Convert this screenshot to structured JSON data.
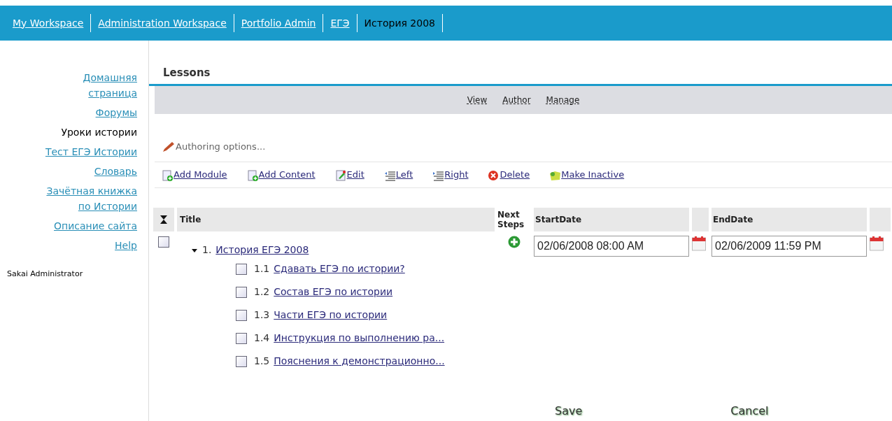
{
  "site_tabs": [
    {
      "label": "My Workspace",
      "selected": false
    },
    {
      "label": "Administration Workspace",
      "selected": false
    },
    {
      "label": "Portfolio Admin",
      "selected": false
    },
    {
      "label": "ЕГЭ",
      "selected": false
    },
    {
      "label": "История 2008",
      "selected": true
    }
  ],
  "sidebar": {
    "items": [
      {
        "label": "Домашняя страница",
        "selected": false
      },
      {
        "label": "Форумы",
        "selected": false
      },
      {
        "label": "Уроки истории",
        "selected": true
      },
      {
        "label": "Тест ЕГЭ Истории",
        "selected": false
      },
      {
        "label": "Словарь",
        "selected": false
      },
      {
        "label": "Зачётная книжка по Истории",
        "selected": false
      },
      {
        "label": "Описание сайта",
        "selected": false
      },
      {
        "label": "Help",
        "selected": false
      }
    ],
    "user": "Sakai Administrator"
  },
  "tool_title": "Lessons",
  "nav": [
    "View",
    "Author",
    "Manage"
  ],
  "authoring_options": "Authoring options...",
  "toolbar": [
    {
      "kind": "add-module",
      "label": "Add Module"
    },
    {
      "kind": "add-content",
      "label": "Add Content"
    },
    {
      "kind": "edit",
      "label": "Edit"
    },
    {
      "kind": "left",
      "label": "Left"
    },
    {
      "kind": "right",
      "label": "Right"
    },
    {
      "kind": "delete",
      "label": "Delete"
    },
    {
      "kind": "inactive",
      "label": "Make Inactive"
    }
  ],
  "table": {
    "columns": [
      "Title",
      "Next Steps",
      "StartDate",
      "EndDate"
    ],
    "rows": [
      {
        "number": "1.",
        "title": "История ЕГЭ 2008",
        "checked": false,
        "expanded": true,
        "start": "02/06/2008 08:00 AM",
        "end": "02/06/2009 11:59 PM",
        "children": [
          {
            "number": "1.1",
            "title": "Сдавать ЕГЭ по истории?",
            "checked": false
          },
          {
            "number": "1.2",
            "title": "Состав ЕГЭ по истории",
            "checked": false
          },
          {
            "number": "1.3",
            "title": "Части ЕГЭ по истории",
            "checked": false
          },
          {
            "number": "1.4",
            "title": "Инструкция по выполнению ра...",
            "checked": false
          },
          {
            "number": "1.5",
            "title": "Пояснения к демонстрационно...",
            "checked": false
          }
        ]
      }
    ]
  },
  "buttons": [
    "Save",
    "Cancel"
  ]
}
